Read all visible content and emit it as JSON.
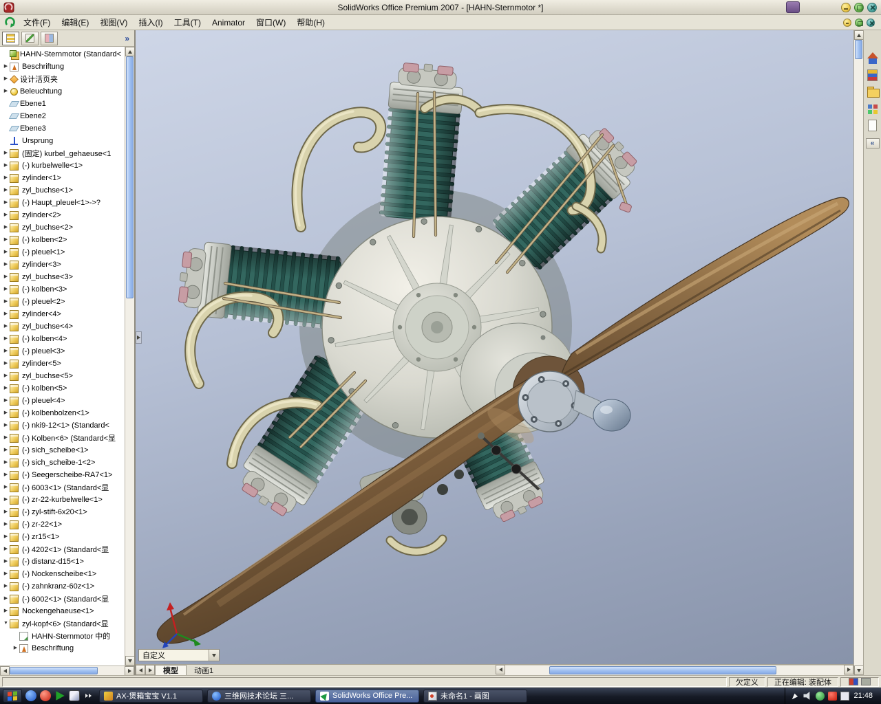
{
  "titlebar": {
    "title": "SolidWorks Office Premium 2007 - [HAHN-Sternmotor *]"
  },
  "menubar": {
    "items": [
      "文件(F)",
      "编辑(E)",
      "视图(V)",
      "插入(I)",
      "工具(T)",
      "Animator",
      "窗口(W)",
      "帮助(H)"
    ]
  },
  "feature_tree": {
    "overflow_chevron": "»",
    "items": [
      {
        "icon": "assembly",
        "label": "HAHN-Sternmotor  (Standard<",
        "arrow": "",
        "indent": 0
      },
      {
        "icon": "annotation",
        "label": "Beschriftung",
        "arrow": "r",
        "indent": 0
      },
      {
        "icon": "binder",
        "label": "设计活页夹",
        "arrow": "r",
        "indent": 0
      },
      {
        "icon": "light",
        "label": "Beleuchtung",
        "arrow": "r",
        "indent": 0
      },
      {
        "icon": "plane",
        "label": "Ebene1",
        "arrow": "",
        "indent": 0
      },
      {
        "icon": "plane",
        "label": "Ebene2",
        "arrow": "",
        "indent": 0
      },
      {
        "icon": "plane",
        "label": "Ebene3",
        "arrow": "",
        "indent": 0
      },
      {
        "icon": "origin",
        "label": "Ursprung",
        "arrow": "",
        "indent": 0
      },
      {
        "icon": "part",
        "label": "(固定) kurbel_gehaeuse<1",
        "arrow": "r",
        "indent": 0
      },
      {
        "icon": "part",
        "label": "(-) kurbelwelle<1>",
        "arrow": "r",
        "indent": 0
      },
      {
        "icon": "part",
        "label": "zylinder<1>",
        "arrow": "r",
        "indent": 0
      },
      {
        "icon": "part",
        "label": "zyl_buchse<1>",
        "arrow": "r",
        "indent": 0
      },
      {
        "icon": "part",
        "label": "(-) Haupt_pleuel<1>->?",
        "arrow": "r",
        "indent": 0
      },
      {
        "icon": "part",
        "label": "zylinder<2>",
        "arrow": "r",
        "indent": 0
      },
      {
        "icon": "part",
        "label": "zyl_buchse<2>",
        "arrow": "r",
        "indent": 0
      },
      {
        "icon": "part",
        "label": "(-) kolben<2>",
        "arrow": "r",
        "indent": 0
      },
      {
        "icon": "part",
        "label": "(-) pleuel<1>",
        "arrow": "r",
        "indent": 0
      },
      {
        "icon": "part",
        "label": "zylinder<3>",
        "arrow": "r",
        "indent": 0
      },
      {
        "icon": "part",
        "label": "zyl_buchse<3>",
        "arrow": "r",
        "indent": 0
      },
      {
        "icon": "part",
        "label": "(-) kolben<3>",
        "arrow": "r",
        "indent": 0
      },
      {
        "icon": "part",
        "label": "(-) pleuel<2>",
        "arrow": "r",
        "indent": 0
      },
      {
        "icon": "part",
        "label": "zylinder<4>",
        "arrow": "r",
        "indent": 0
      },
      {
        "icon": "part",
        "label": "zyl_buchse<4>",
        "arrow": "r",
        "indent": 0
      },
      {
        "icon": "part",
        "label": "(-) kolben<4>",
        "arrow": "r",
        "indent": 0
      },
      {
        "icon": "part",
        "label": "(-) pleuel<3>",
        "arrow": "r",
        "indent": 0
      },
      {
        "icon": "part",
        "label": "zylinder<5>",
        "arrow": "r",
        "indent": 0
      },
      {
        "icon": "part",
        "label": "zyl_buchse<5>",
        "arrow": "r",
        "indent": 0
      },
      {
        "icon": "part",
        "label": "(-) kolben<5>",
        "arrow": "r",
        "indent": 0
      },
      {
        "icon": "part",
        "label": "(-) pleuel<4>",
        "arrow": "r",
        "indent": 0
      },
      {
        "icon": "part",
        "label": "(-) kolbenbolzen<1>",
        "arrow": "r",
        "indent": 0
      },
      {
        "icon": "part",
        "label": "(-) nki9-12<1> (Standard<",
        "arrow": "r",
        "indent": 0
      },
      {
        "icon": "part",
        "label": "(-) Kolben<6> (Standard<显",
        "arrow": "r",
        "indent": 0
      },
      {
        "icon": "part",
        "label": "(-) sich_scheibe<1>",
        "arrow": "r",
        "indent": 0
      },
      {
        "icon": "part",
        "label": "(-) sich_scheibe-1<2>",
        "arrow": "r",
        "indent": 0
      },
      {
        "icon": "part",
        "label": "(-) Seegerscheibe-RA7<1>",
        "arrow": "r",
        "indent": 0
      },
      {
        "icon": "part",
        "label": "(-) 6003<1> (Standard<显",
        "arrow": "r",
        "indent": 0
      },
      {
        "icon": "part",
        "label": "(-) zr-22-kurbelwelle<1>",
        "arrow": "r",
        "indent": 0
      },
      {
        "icon": "part",
        "label": "(-) zyl-stift-6x20<1>",
        "arrow": "r",
        "indent": 0
      },
      {
        "icon": "part",
        "label": "(-) zr-22<1>",
        "arrow": "r",
        "indent": 0
      },
      {
        "icon": "part",
        "label": "(-) zr15<1>",
        "arrow": "r",
        "indent": 0
      },
      {
        "icon": "part",
        "label": "(-) 4202<1> (Standard<显",
        "arrow": "r",
        "indent": 0
      },
      {
        "icon": "part",
        "label": "(-) distanz-d15<1>",
        "arrow": "r",
        "indent": 0
      },
      {
        "icon": "part",
        "label": "(-) Nockenscheibe<1>",
        "arrow": "r",
        "indent": 0
      },
      {
        "icon": "part",
        "label": "(-) zahnkranz-60z<1>",
        "arrow": "r",
        "indent": 0
      },
      {
        "icon": "part",
        "label": "(-) 6002<1> (Standard<显",
        "arrow": "r",
        "indent": 0
      },
      {
        "icon": "part",
        "label": "Nockengehaeuse<1>",
        "arrow": "r",
        "indent": 0
      },
      {
        "icon": "part",
        "label": "zyl-kopf<6> (Standard<显",
        "arrow": "d",
        "indent": 0
      },
      {
        "icon": "note",
        "label": "HAHN-Sternmotor 中的",
        "arrow": "",
        "indent": 1
      },
      {
        "icon": "annotation",
        "label": "Beschriftung",
        "arrow": "r",
        "indent": 1
      }
    ]
  },
  "viewport": {
    "config_combo": "自定义",
    "model_tab": "模型",
    "anim_tab": "动画1"
  },
  "taskpane": {
    "icons": [
      "resources-home",
      "design-library",
      "file-explorer",
      "view-palette",
      "document"
    ],
    "collapse_label": "«"
  },
  "statusbar": {
    "definition_status": "欠定义",
    "editing": "正在编辑: 装配体"
  },
  "taskbar": {
    "quick_launch": [
      "ie",
      "opera",
      "media",
      "desktop"
    ],
    "tasks": [
      {
        "icon": "ax",
        "label": "AX-煲箱宝宝 V1.1",
        "active": false
      },
      {
        "icon": "ie",
        "label": "三维网技术论坛 三...",
        "active": false
      },
      {
        "icon": "solidworks",
        "label": "SolidWorks Office Pre...",
        "active": true
      },
      {
        "icon": "paint",
        "label": "未命名1 - 画图",
        "active": false
      }
    ],
    "tray_icons": [
      "pen",
      "speaker",
      "shield",
      "ati",
      "ime"
    ],
    "clock": "21:48"
  },
  "colors": {
    "chrome": "#e6e3d6",
    "viewport_top": "#ced6e7",
    "viewport_bottom": "#8792a9",
    "scrollbar_thumb": "#9fc0f0",
    "taskbar_active": "#49619a",
    "propeller_brown": "#7a5c3b",
    "cylinder_teal": "#33675f",
    "pipe_cream": "#d9d3ad",
    "crankcase_gray": "#d9d9d0"
  }
}
